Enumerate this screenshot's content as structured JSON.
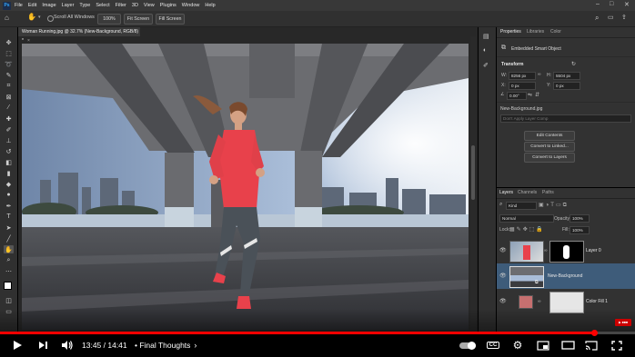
{
  "menubar": {
    "app_logo": "Ps",
    "items": [
      "File",
      "Edit",
      "Image",
      "Layer",
      "Type",
      "Select",
      "Filter",
      "3D",
      "View",
      "Plugins",
      "Window",
      "Help"
    ]
  },
  "options": {
    "scroll_all_windows": "Scroll All Windows",
    "zoom_100": "100%",
    "fit_screen": "Fit Screen",
    "fill_screen": "Fill Screen"
  },
  "document": {
    "tab_title": "Woman Running.jpg @ 32.7% (New-Background, RGB/8) *"
  },
  "properties": {
    "tabs": [
      "Properties",
      "Libraries",
      "Color"
    ],
    "kind": "Embedded Smart Object",
    "transform_label": "Transform",
    "w_label": "W:",
    "w_value": "8256 px",
    "h_label": "H:",
    "h_value": "5504 px",
    "x_label": "X:",
    "x_value": "0 px",
    "y_label": "Y:",
    "y_value": "0 px",
    "angle_value": "0.00°",
    "source_name": "New-Background.jpg",
    "layer_comp_placeholder": "Don't Apply Layer Comp",
    "buttons": [
      "Edit Contents",
      "Convert to Linked...",
      "Convert to Layers"
    ]
  },
  "layers_panel": {
    "tabs": [
      "Layers",
      "Channels",
      "Paths"
    ],
    "filter_kind": "Kind",
    "blend_mode": "Normal",
    "opacity_label": "Opacity:",
    "opacity_value": "100%",
    "lock_label": "Lock:",
    "fill_label": "Fill:",
    "fill_value": "100%",
    "layers": [
      {
        "name": "Layer 0"
      },
      {
        "name": "New-Background"
      },
      {
        "name": "Color Fill 1"
      }
    ]
  },
  "player": {
    "current_time": "13:45",
    "duration": "14:41",
    "time_display": "13:45 / 14:41",
    "chapter": "• Final Thoughts",
    "progress": 0.936,
    "cc_label": "CC"
  },
  "colors": {
    "ps_bg": "#282828",
    "panel_bg": "#323232",
    "accent": "#ff0000",
    "jacket": "#e8414b",
    "selected_layer": "#3e5c7a"
  },
  "icons": [
    "move-icon",
    "hand-icon",
    "search-icon",
    "home-icon",
    "share-icon",
    "play-icon",
    "next-icon",
    "volume-icon",
    "settings-icon",
    "miniplayer-icon",
    "theater-icon",
    "cast-icon",
    "fullscreen-icon",
    "eye-icon"
  ]
}
